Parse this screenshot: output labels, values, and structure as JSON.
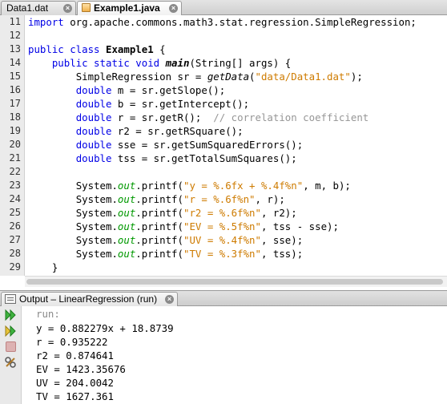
{
  "editor": {
    "tabs": [
      {
        "label": "Data1.dat",
        "active": false
      },
      {
        "label": "Example1.java",
        "active": true
      }
    ],
    "line_numbers": [
      "11",
      "12",
      "13",
      "14",
      "15",
      "16",
      "17",
      "18",
      "19",
      "20",
      "21",
      "22",
      "23",
      "24",
      "25",
      "26",
      "27",
      "28",
      "29"
    ],
    "code": {
      "l11_kw": "import",
      "l11_rest": " org.apache.commons.math3.stat.regression.SimpleRegression;",
      "l13_kw": "public class",
      "l13_name": "Example1",
      "l13_rest": " {",
      "l14_kw": "public static void",
      "l14_name": "main",
      "l14_rest": "(String[] args) {",
      "l15_a": "SimpleRegression sr = ",
      "l15_fn": "getData",
      "l15_b": "(",
      "l15_str": "\"data/Data1.dat\"",
      "l15_c": ");",
      "l16_kw": "double",
      "l16_rest": " m = sr.getSlope();",
      "l17_kw": "double",
      "l17_rest": " b = sr.getIntercept();",
      "l18_kw": "double",
      "l18_rest": " r = sr.getR();  ",
      "l18_cmt": "// correlation coefficient",
      "l19_kw": "double",
      "l19_rest": " r2 = sr.getRSquare();",
      "l20_kw": "double",
      "l20_rest": " sse = sr.getSumSquaredErrors();",
      "l21_kw": "double",
      "l21_rest": " tss = sr.getTotalSumSquares();",
      "system": "System.",
      "out": "out",
      "printf": ".printf(",
      "l23_str": "\"y = %.6fx + %.4f%n\"",
      "l23_rest": ", m, b);",
      "l24_str": "\"r = %.6f%n\"",
      "l24_rest": ", r);",
      "l25_str": "\"r2 = %.6f%n\"",
      "l25_rest": ", r2);",
      "l26_str": "\"EV = %.5f%n\"",
      "l26_rest": ", tss - sse);",
      "l27_str": "\"UV = %.4f%n\"",
      "l27_rest": ", sse);",
      "l28_str": "\"TV = %.3f%n\"",
      "l28_rest": ", tss);",
      "l29": "}"
    }
  },
  "output": {
    "tab_label": "Output – LinearRegression (run)",
    "lines": [
      "run:",
      "y = 0.882279x + 18.8739",
      "r = 0.935222",
      "r2 = 0.874641",
      "EV = 1423.35676",
      "UV = 204.0042",
      "TV = 1627.361"
    ],
    "toolbar_icons": [
      "rerun-icon",
      "rerun-with-options-icon",
      "stop-icon",
      "settings-icon"
    ]
  },
  "colors": {
    "keyword": "#0000e6",
    "string": "#ce7b00",
    "comment": "#969696",
    "static_field": "#009900",
    "run_icon": "#2ea02e"
  }
}
